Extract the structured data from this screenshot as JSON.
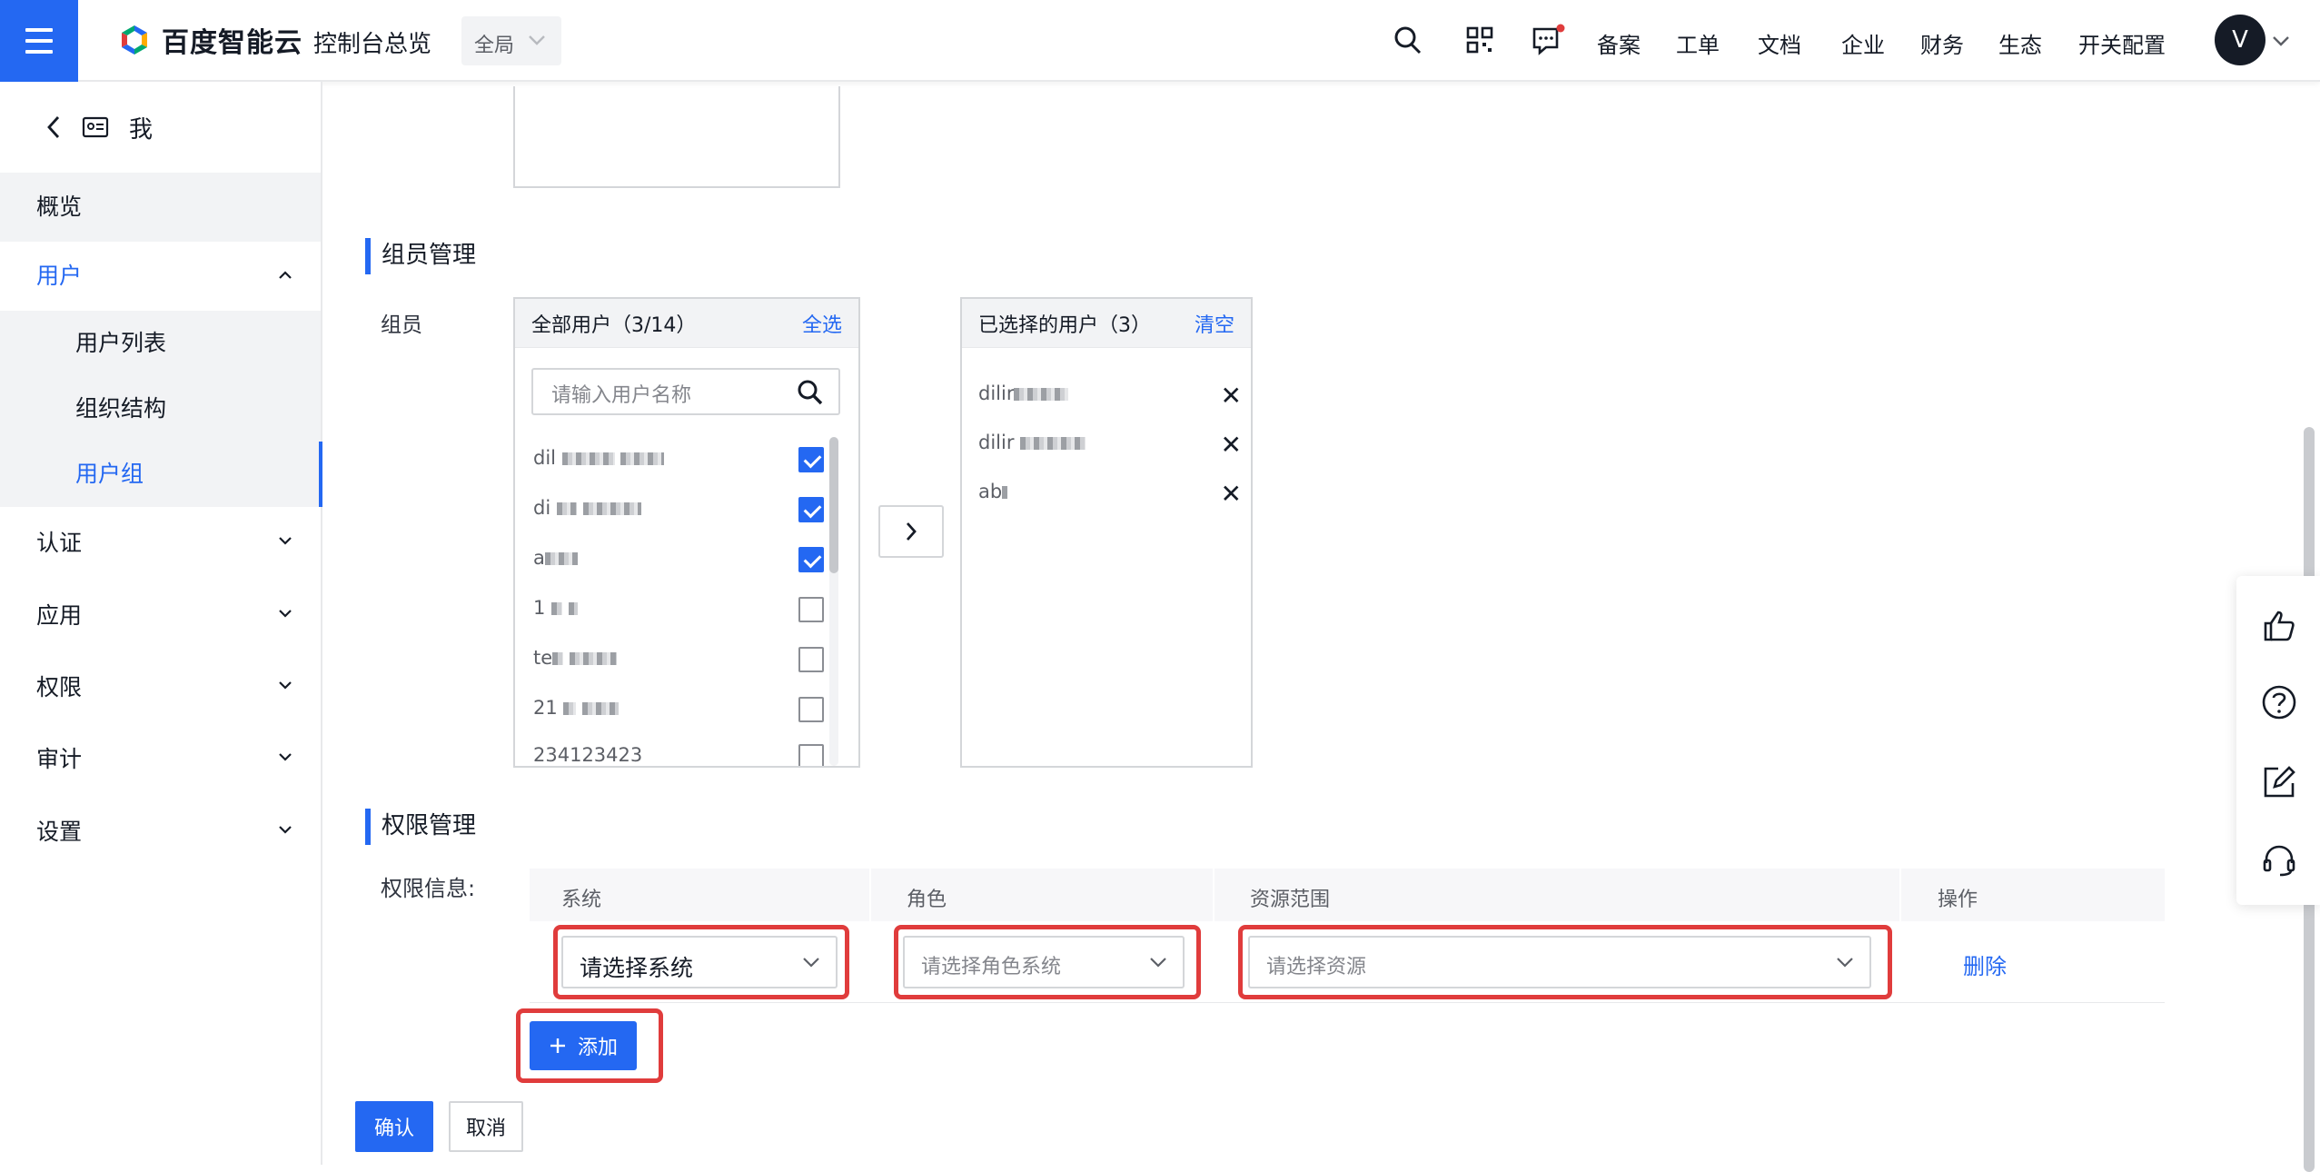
{
  "topbar": {
    "brand": "百度智能云",
    "console_title": "控制台总览",
    "region": "全局",
    "links": [
      "备案",
      "工单",
      "文档",
      "企业",
      "财务",
      "生态",
      "开关配置"
    ],
    "avatar_letter": "V",
    "accent": "#2468f2",
    "notification_dot": "#e03c3c"
  },
  "sidebar": {
    "header": "我",
    "items": [
      {
        "label": "概览"
      },
      {
        "label": "用户",
        "expanded": true,
        "children": [
          {
            "label": "用户列表"
          },
          {
            "label": "组织结构"
          },
          {
            "label": "用户组",
            "selected": true
          }
        ]
      },
      {
        "label": "认证"
      },
      {
        "label": "应用"
      },
      {
        "label": "权限"
      },
      {
        "label": "审计"
      },
      {
        "label": "设置"
      }
    ]
  },
  "members": {
    "section_title": "组员管理",
    "field_label": "组员",
    "all_users": {
      "title": "全部用户（3/14）",
      "select_all": "全选",
      "search_placeholder": "请输入用户名称",
      "rows": [
        {
          "prefix": "dil",
          "checked": true
        },
        {
          "prefix": "di",
          "checked": true
        },
        {
          "prefix": "a",
          "checked": true
        },
        {
          "prefix": "1",
          "checked": false
        },
        {
          "prefix": "te",
          "checked": false
        },
        {
          "prefix": "21",
          "checked": false
        },
        {
          "prefix": "234123423",
          "checked": false
        }
      ]
    },
    "selected_users": {
      "title": "已选择的用户（3）",
      "clear": "清空",
      "rows": [
        {
          "prefix": "dilir"
        },
        {
          "prefix": "dilir"
        },
        {
          "prefix": "ab"
        }
      ]
    }
  },
  "permissions": {
    "section_title": "权限管理",
    "field_label": "权限信息:",
    "columns": [
      "系统",
      "角色",
      "资源范围",
      "操作"
    ],
    "row": {
      "system_placeholder": "请选择系统",
      "role_placeholder": "请选择角色系统",
      "resource_placeholder": "请选择资源",
      "delete": "删除"
    },
    "add_button": "添加"
  },
  "footer": {
    "confirm": "确认",
    "cancel": "取消"
  }
}
